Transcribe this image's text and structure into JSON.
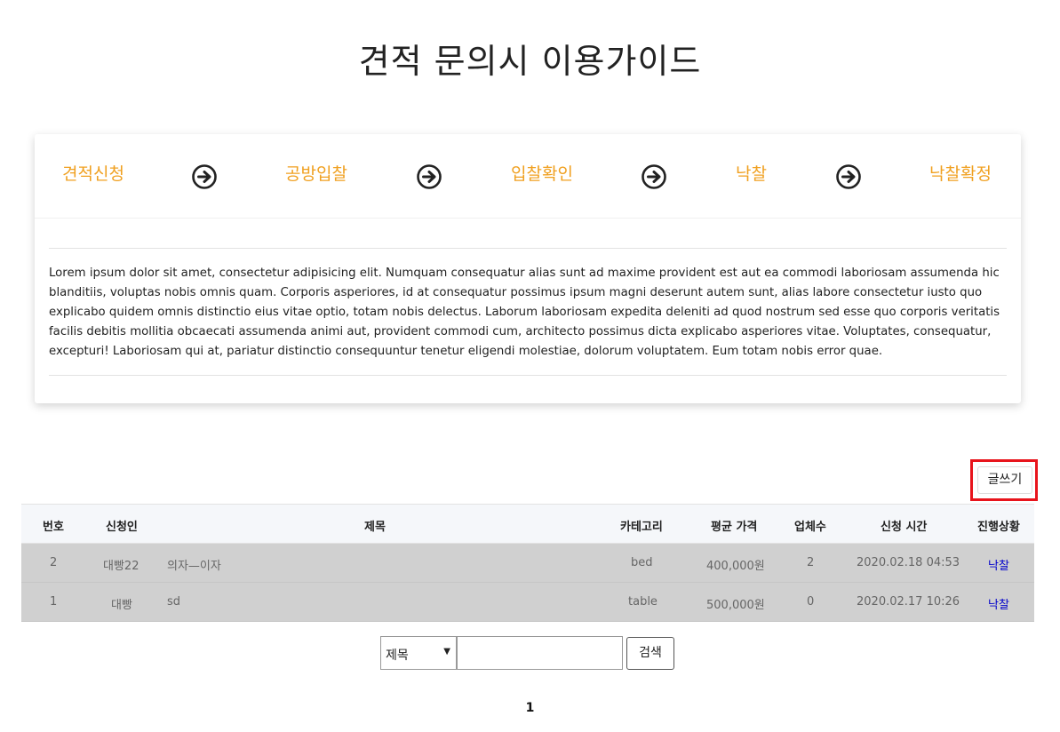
{
  "title": "견적 문의시 이용가이드",
  "steps": [
    {
      "label": "견적신청"
    },
    {
      "label": "공방입찰"
    },
    {
      "label": "입찰확인"
    },
    {
      "label": "낙찰"
    },
    {
      "label": "낙찰확정"
    }
  ],
  "step_icon": "arrow-circle-right-icon",
  "guide_text": "Lorem ipsum dolor sit amet, consectetur adipisicing elit. Numquam consequatur alias sunt ad maxime provident est aut ea commodi laboriosam assumenda hic blanditiis, voluptas nobis omnis quam. Corporis asperiores, id at consequatur possimus ipsum magni deserunt autem sunt, alias labore consectetur iusto quo explicabo quidem omnis distinctio eius vitae optio, totam nobis delectus. Laborum laboriosam expedita deleniti ad quod nostrum sed esse quo corporis veritatis facilis debitis mollitia obcaecati assumenda animi aut, provident commodi cum, architecto possimus dicta explicabo asperiores vitae. Voluptates, consequatur, excepturi! Laboriosam qui at, pariatur distinctio consequuntur tenetur eligendi molestiae, dolorum voluptatem. Eum totam nobis error quae.",
  "write_button": "글쓰기",
  "table": {
    "headers": {
      "no": "번호",
      "applicant": "신청인",
      "title": "제목",
      "category": "카테고리",
      "avg_price": "평균 가격",
      "companies": "업체수",
      "time": "신청 시간",
      "status": "진행상황"
    },
    "rows": [
      {
        "no": "2",
        "applicant": "대빵22",
        "title": "의자—이자",
        "category": "bed",
        "avg_price": "400,000원",
        "companies": "2",
        "time": "2020.02.18 04:53",
        "status": "낙찰"
      },
      {
        "no": "1",
        "applicant": "대빵",
        "title": "sd",
        "category": "table",
        "avg_price": "500,000원",
        "companies": "0",
        "time": "2020.02.17 10:26",
        "status": "낙찰"
      }
    ]
  },
  "search": {
    "select_value": "제목",
    "input_value": "",
    "button": "검색"
  },
  "pagination": {
    "current": "1"
  },
  "colors": {
    "step_text": "#f0a020",
    "row_bg": "#d0d0d0",
    "status_link": "#0000cc",
    "highlight_border": "#e8141c"
  }
}
